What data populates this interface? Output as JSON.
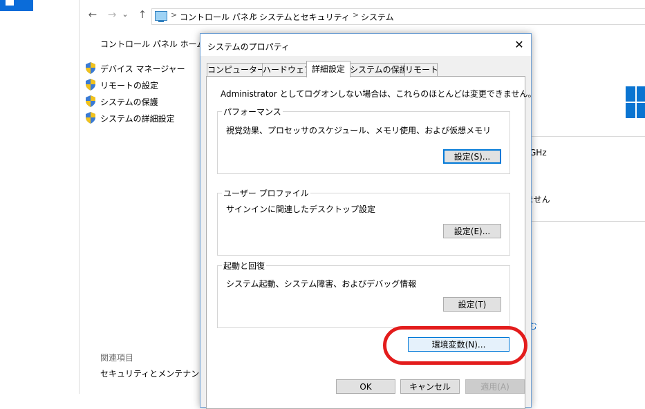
{
  "breadcrumb": {
    "items": [
      "コントロール パネル",
      "システムとセキュリティ",
      "システム"
    ],
    "separator": ">"
  },
  "nav": {
    "back": "←",
    "forward": "→",
    "recent": "⌄",
    "up": "↑"
  },
  "sidebar": {
    "home": "コントロール パネル ホーム",
    "links": [
      "デバイス マネージャー",
      "リモートの設定",
      "システムの保護",
      "システムの詳細設定"
    ],
    "related_title": "関連項目",
    "related_links": [
      "セキュリティとメンテナンス"
    ]
  },
  "background_fragments": {
    "ghz": "GHz",
    "sen": "ません",
    "mu": "む"
  },
  "dialog": {
    "title": "システムのプロパティ",
    "close": "✕",
    "tabs": [
      "コンピューター名",
      "ハードウェア",
      "詳細設定",
      "システムの保護",
      "リモート"
    ],
    "active_tab": "詳細設定",
    "admin_note": "Administrator としてログオンしない場合は、これらのほとんどは変更できません。",
    "groups": {
      "performance": {
        "title": "パフォーマンス",
        "desc": "視覚効果、プロセッサのスケジュール、メモリ使用、および仮想メモリ",
        "button": "設定(S)..."
      },
      "user_profile": {
        "title": "ユーザー プロファイル",
        "desc": "サインインに関連したデスクトップ設定",
        "button": "設定(E)..."
      },
      "startup": {
        "title": "起動と回復",
        "desc": "システム起動、システム障害、およびデバッグ情報",
        "button": "設定(T)"
      }
    },
    "env_button": "環境変数(N)...",
    "ok": "OK",
    "cancel": "キャンセル",
    "apply": "適用(A)"
  },
  "colors": {
    "accent": "#0078d7",
    "highlight": "#e31c1c",
    "windows_blue": "#0a74d1"
  },
  "icons": {
    "shield": "uac-shield-icon",
    "computer": "computer-icon",
    "close": "close-icon",
    "windows": "windows-logo-icon"
  }
}
